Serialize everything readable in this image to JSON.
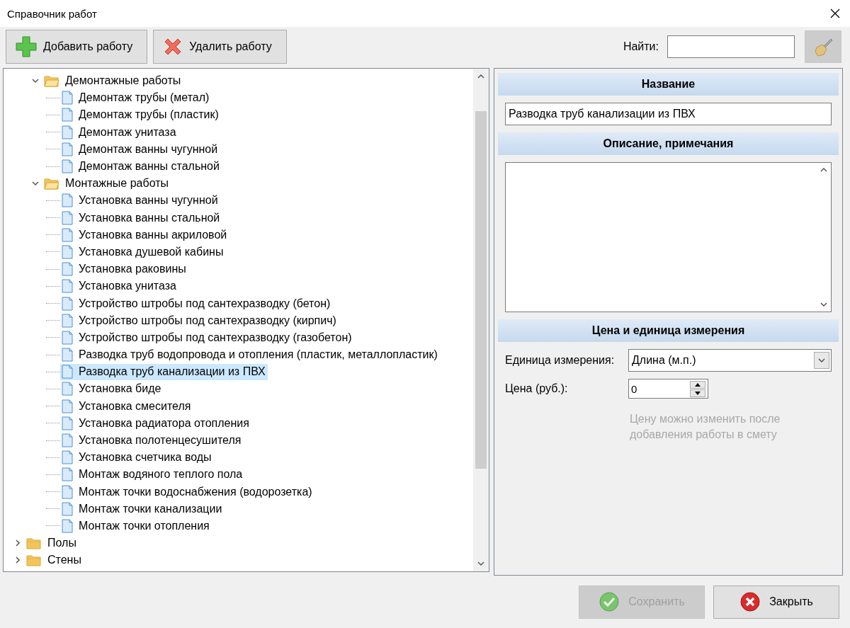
{
  "window": {
    "title": "Справочник работ"
  },
  "toolbar": {
    "buttons": [
      {
        "kind": "add",
        "label": "Добавить работу"
      },
      {
        "kind": "delete",
        "label": "Удалить работу"
      }
    ],
    "search": {
      "label": "Найти:"
    }
  },
  "tree": {
    "items": [
      {
        "children": [
          {
            "kind": "folder",
            "label": "Демонтажные работы",
            "expanded": true,
            "selected": false,
            "children": [
              {
                "kind": "doc",
                "label": "Демонтаж трубы (метал)",
                "selected": false
              },
              {
                "kind": "doc",
                "label": "Демонтаж трубы (пластик)",
                "selected": false
              },
              {
                "kind": "doc",
                "label": "Демонтаж унитаза",
                "selected": false
              },
              {
                "kind": "doc",
                "label": "Демонтаж ванны чугунной",
                "selected": false
              },
              {
                "kind": "doc",
                "label": "Демонтаж ванны стальной",
                "selected": false
              }
            ]
          },
          {
            "kind": "folder",
            "label": "Монтажные работы",
            "expanded": true,
            "selected": false,
            "children": [
              {
                "kind": "doc",
                "label": "Установка ванны чугунной",
                "selected": false
              },
              {
                "kind": "doc",
                "label": "Установка ванны стальной",
                "selected": false
              },
              {
                "kind": "doc",
                "label": "Установка ванны акриловой",
                "selected": false
              },
              {
                "kind": "doc",
                "label": "Установка душевой кабины",
                "selected": false
              },
              {
                "kind": "doc",
                "label": "Установка раковины",
                "selected": false
              },
              {
                "kind": "doc",
                "label": "Установка унитаза",
                "selected": false
              },
              {
                "kind": "doc",
                "label": "Устройство штробы под сантехразводку (бетон)",
                "selected": false
              },
              {
                "kind": "doc",
                "label": "Устройство штробы под сантехразводку (кирпич)",
                "selected": false
              },
              {
                "kind": "doc",
                "label": "Устройство штробы под сантехразводку (газобетон)",
                "selected": false
              },
              {
                "kind": "doc",
                "label": "Разводка труб водопровода и отопления (пластик, металлопластик)",
                "selected": false
              },
              {
                "kind": "doc",
                "label": "Разводка труб канализации из ПВХ",
                "selected": true
              },
              {
                "kind": "doc",
                "label": "Установка биде",
                "selected": false
              },
              {
                "kind": "doc",
                "label": "Установка смесителя",
                "selected": false
              },
              {
                "kind": "doc",
                "label": "Установка радиатора отопления",
                "selected": false
              },
              {
                "kind": "doc",
                "label": "Установка полотенцесушителя",
                "selected": false
              },
              {
                "kind": "doc",
                "label": "Установка счетчика воды",
                "selected": false
              },
              {
                "kind": "doc",
                "label": "Монтаж водяного теплого пола",
                "selected": false
              },
              {
                "kind": "doc",
                "label": "Монтаж точки водоснабжения (водорозетка)",
                "selected": false
              },
              {
                "kind": "doc",
                "label": "Монтаж точки канализации",
                "selected": false
              },
              {
                "kind": "doc",
                "label": "Монтаж точки отопления",
                "selected": false
              }
            ]
          }
        ]
      },
      {
        "kind": "folder",
        "label": "Полы",
        "expanded": false,
        "selected": false
      },
      {
        "kind": "folder",
        "label": "Стены",
        "expanded": false,
        "selected": false
      }
    ]
  },
  "name_section": {
    "title": "Название",
    "value": "Разводка труб канализации из ПВХ"
  },
  "description_section": {
    "title": "Описание, примечания"
  },
  "price_section": {
    "title": "Цена и единица измерения",
    "unit_label": "Единица измерения:",
    "unit_value": "Длина (м.п.)",
    "price_label": "Цена (руб.):",
    "price_value": "0",
    "hint": "Цену можно изменить после добавления работы в смету"
  },
  "footer": {
    "buttons": [
      {
        "kind": "save",
        "label": "Сохранить",
        "disabled": true
      },
      {
        "kind": "close",
        "label": "Закрыть",
        "disabled": false
      }
    ]
  }
}
